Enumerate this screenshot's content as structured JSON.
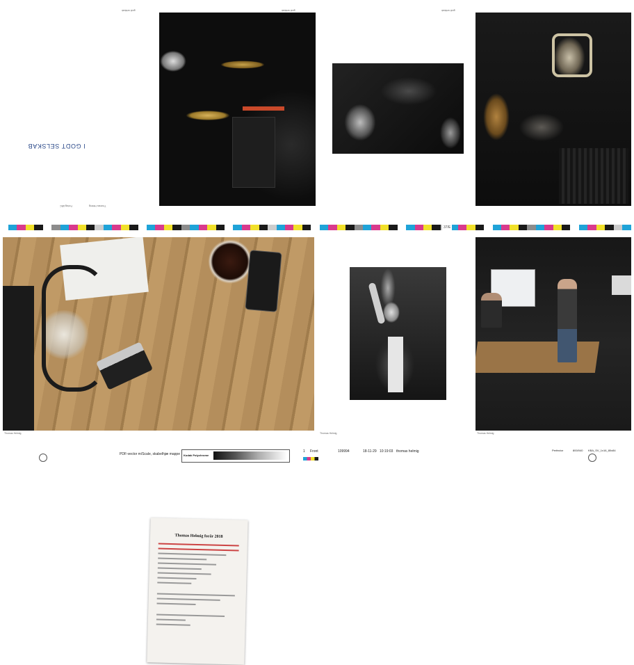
{
  "spread_top": {
    "chapter_title": "I GODT SELSKAB",
    "folio_left": "Forlag ABC",
    "folio_mid": "Thomas Helmig",
    "crop_note_1": "godt selskab",
    "crop_note_2": "godt selskab",
    "crop_note_3": "godt selskab"
  },
  "spread_bottom": {
    "setlist_title": "Thomas Helmig forår 2018",
    "crop_note_1": "Thomas Helmig",
    "crop_note_2": "Thomas Helmig",
    "crop_note_3": "Thomas Helmig"
  },
  "slug": {
    "pdf_note": "PDF-vector m/Scale, skabelhjæ mappe",
    "brand": "Kodak Polychrome",
    "page_number": "1",
    "side": "Front",
    "job_number": "109994",
    "date": "18-11-29",
    "time": "10:19:03",
    "job_name": "thomas helmig",
    "perfector": "Perfector",
    "code": "800/040",
    "format": "KBA_SV_1x16_80x84",
    "center_mark": "37/E"
  },
  "colors": {
    "cyan": "#1fa3d8",
    "magenta": "#d93a8c",
    "yellow": "#f1e02a",
    "black": "#1a1a1a",
    "title_blue": "#2c4a8a"
  }
}
